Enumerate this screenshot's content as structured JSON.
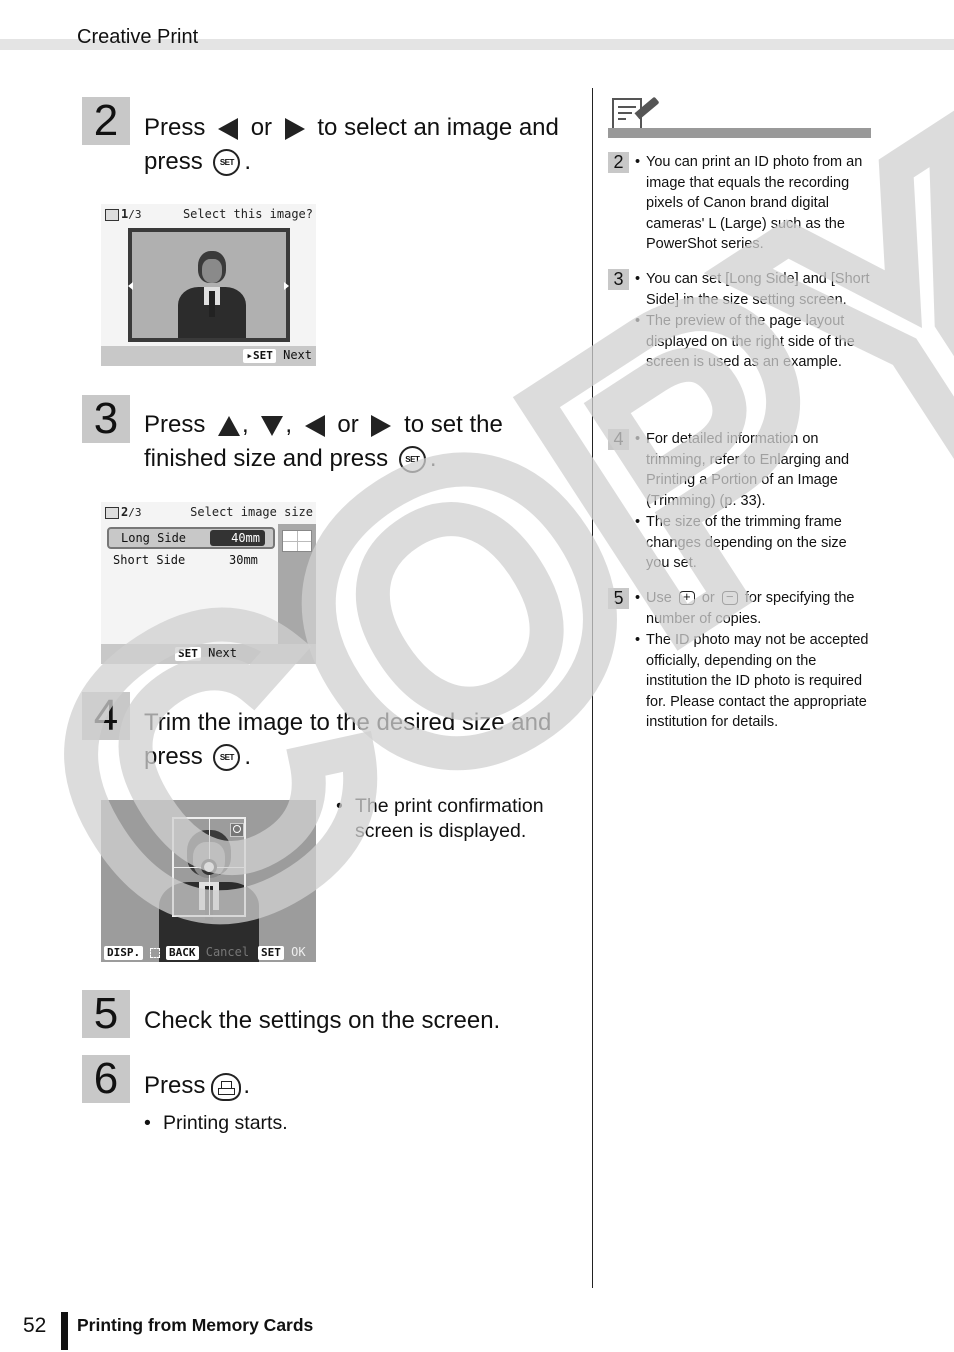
{
  "header": {
    "section_title": "Creative Print"
  },
  "steps": [
    {
      "num": "2",
      "line1_a": "Press",
      "line1_b": "or",
      "line1_c": "to select an image and",
      "line2_a": "press",
      "line2_end": "."
    },
    {
      "num": "3",
      "line1_a": "Press",
      "sep1": ",",
      "sep2": ",",
      "line1_b": "or",
      "line1_c": "to set the",
      "line2_a": "finished size and press",
      "line2_end": "."
    },
    {
      "num": "4",
      "line1": "Trim the image to the desired size and",
      "line2_a": "press",
      "line2_end": ".",
      "bullet": "The print confirmation screen is displayed."
    },
    {
      "num": "5",
      "text": "Check the settings on the screen."
    },
    {
      "num": "6",
      "text_a": "Press",
      "text_end": ".",
      "bullet": "Printing starts."
    }
  ],
  "buttons": {
    "set_label": "SET"
  },
  "screens": {
    "select_image": {
      "counter": "1",
      "counter_total": "/3",
      "title": "Select this image?",
      "set_tag": "▸SET",
      "action": "Next"
    },
    "image_size": {
      "counter": "2",
      "counter_total": "/3",
      "title": "Select image size",
      "rows": [
        {
          "label": "Long Side",
          "value": "40mm"
        },
        {
          "label": "Short Side",
          "value": "30mm"
        }
      ],
      "set_tag": "SET",
      "action": "Next"
    },
    "trim": {
      "disp_tag": "DISP.",
      "back_tag": "BACK",
      "back_action": "Cancel",
      "set_tag": "SET",
      "set_action": "OK"
    }
  },
  "notes": [
    {
      "num": "2",
      "items": [
        "You can print an ID photo from an image that equals the recording pixels of Canon brand digital cameras' L (Large) such as the PowerShot series."
      ]
    },
    {
      "num": "3",
      "items": [
        "You can set [Long Side] and [Short Side] in the size setting screen.",
        "The preview of the page layout displayed on the right side of the screen is used as an example."
      ]
    },
    {
      "num": "4",
      "items": [
        "For detailed information on trimming, refer to Enlarging and Printing a Portion of an Image (Trimming) (p. 33).",
        "The size of the trimming frame changes depending on the size you set."
      ]
    },
    {
      "num": "5",
      "item1_a": "Use",
      "item1_b": "or",
      "item1_c": "for specifying the number of copies.",
      "plus": "+",
      "minus": "−",
      "items": [
        "The ID photo may not be accepted officially, depending on the institution the ID photo is required for. Please contact the appropriate institution for details."
      ]
    }
  ],
  "bullet_char": "•",
  "watermark": "COPY",
  "footer": {
    "page_number": "52",
    "chapter": "Printing from Memory Cards"
  }
}
